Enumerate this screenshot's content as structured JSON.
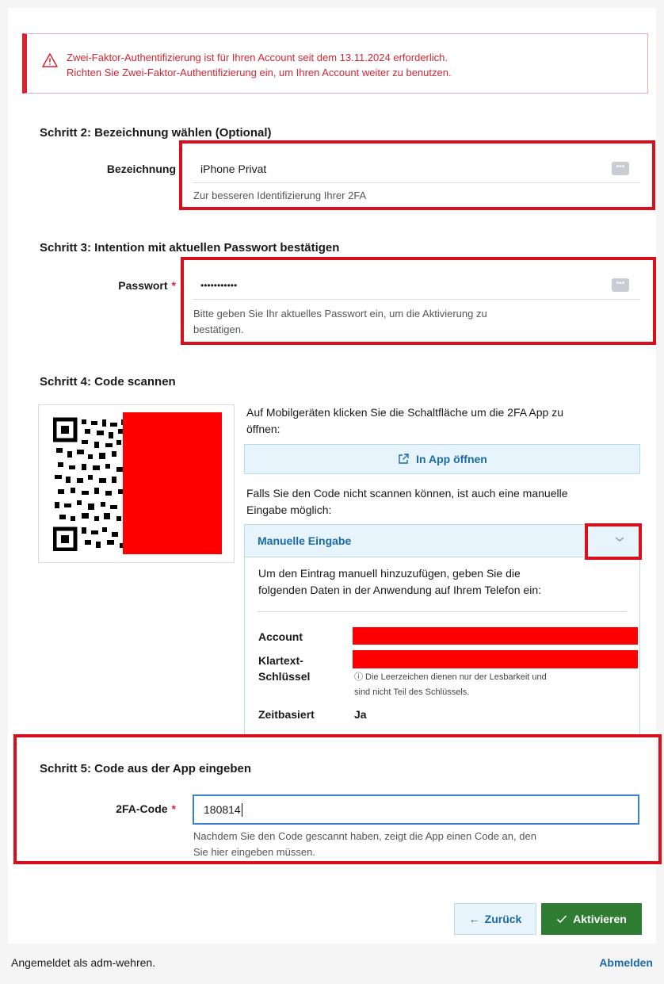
{
  "alert": {
    "line1": "Zwei-Faktor-Authentifizierung ist für Ihren Account seit dem 13.11.2024 erforderlich.",
    "line2": "Richten Sie Zwei-Faktor-Authentifizierung ein, um Ihren Account weiter zu benutzen.",
    "icon": "warning-icon"
  },
  "step2": {
    "heading": "Schritt 2: Bezeichnung wählen (Optional)",
    "label": "Bezeichnung",
    "value": "iPhone Privat",
    "help": "Zur besseren Identifizierung Ihrer 2FA"
  },
  "step3": {
    "heading": "Schritt 3: Intention mit aktuellen Passwort bestätigen",
    "label": "Passwort",
    "required_mark": "*",
    "value": "•••••••••••",
    "help_line1": "Bitte geben Sie Ihr aktuelles Passwort ein, um die Aktivierung zu",
    "help_line2": "bestätigen."
  },
  "step4": {
    "heading": "Schritt 4: Code scannen",
    "mobile_text_line1": "Auf Mobilgeräten klicken Sie die Schaltfläche um die 2FA App zu",
    "mobile_text_line2": "öffnen:",
    "open_app_label": "In App öffnen",
    "manual_text_line1": "Falls Sie den Code nicht scannen können, ist auch eine manuelle",
    "manual_text_line2": "Eingabe möglich:",
    "accordion_title": "Manuelle Eingabe",
    "accordion_intro_line1": "Um den Eintrag manuell hinzuzufügen, geben Sie die",
    "accordion_intro_line2": "folgenden Daten in der Anwendung auf Ihrem Telefon ein:",
    "account_label": "Account",
    "key_label_line1": "Klartext-",
    "key_label_line2": "Schlüssel",
    "key_note_line1": "ⓘ Die Leerzeichen dienen nur der Lesbarkeit und",
    "key_note_line2": "sind nicht Teil des Schlüssels.",
    "timebased_label": "Zeitbasiert",
    "timebased_value": "Ja"
  },
  "step5": {
    "heading": "Schritt 5: Code aus der App eingeben",
    "label": "2FA-Code",
    "required_mark": "*",
    "value": "180814",
    "help_line1": "Nachdem Sie den Code gescannt haben, zeigt die App einen Code an, den",
    "help_line2": "Sie hier eingeben müssen."
  },
  "buttons": {
    "back": "Zurück",
    "activate": "Aktivieren"
  },
  "footer": {
    "logged_in": "Angemeldet als adm-wehren.",
    "logout": "Abmelden"
  },
  "colors": {
    "error": "#d62431",
    "annotation_red": "#d8101e",
    "primary_blue": "#1b6aa8",
    "success_green": "#2e7d32"
  }
}
